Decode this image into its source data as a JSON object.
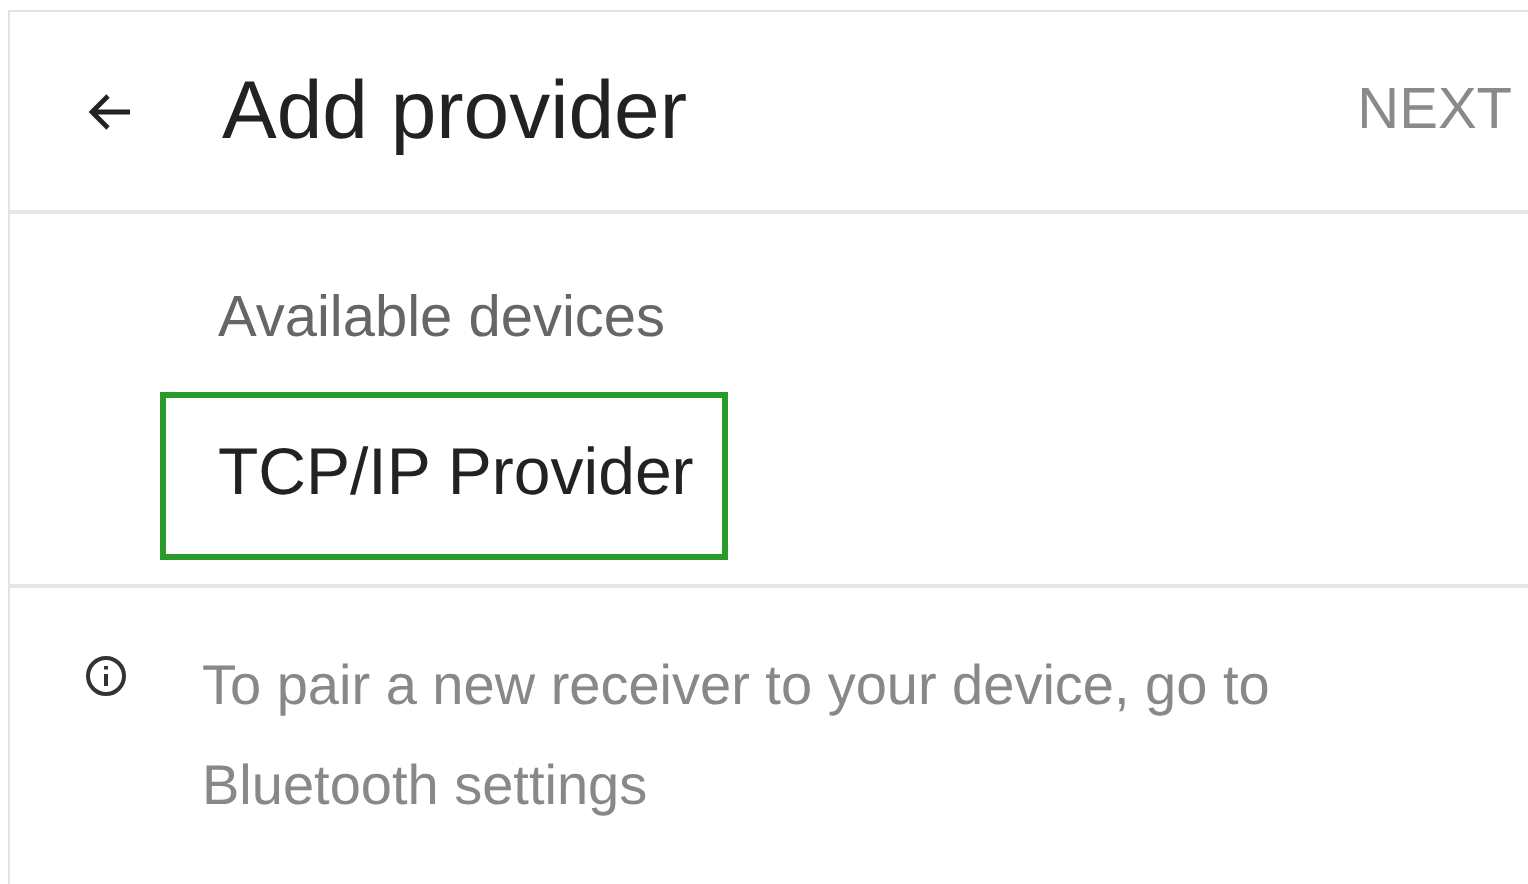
{
  "header": {
    "title": "Add provider",
    "action": "NEXT"
  },
  "section": {
    "heading": "Available devices",
    "devices": [
      {
        "label": "TCP/IP Provider",
        "highlighted": true
      }
    ]
  },
  "info": {
    "text": "To pair a new receiver to your device, go to Bluetooth settings"
  }
}
